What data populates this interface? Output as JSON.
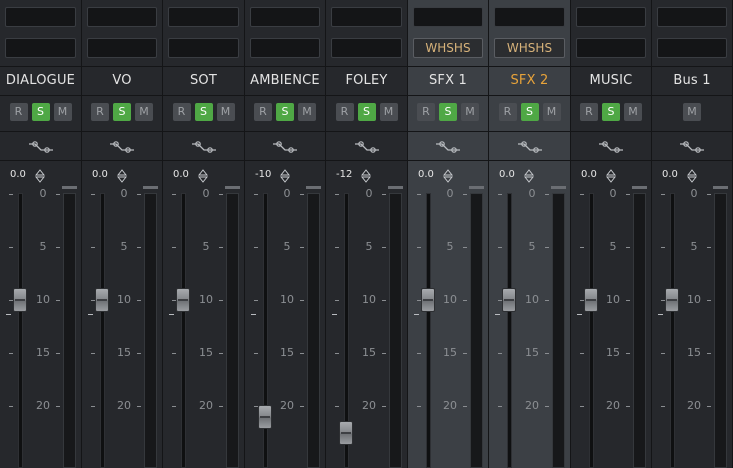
{
  "channels": [
    {
      "name": "DIALOGUE",
      "insert": "",
      "accent": false,
      "selected": false,
      "buttons": [
        "R",
        "S",
        "M"
      ],
      "gain": "0.0",
      "fader_db": 10
    },
    {
      "name": "VO",
      "insert": "",
      "accent": false,
      "selected": false,
      "buttons": [
        "R",
        "S",
        "M"
      ],
      "gain": "0.0",
      "fader_db": 10
    },
    {
      "name": "SOT",
      "insert": "",
      "accent": false,
      "selected": false,
      "buttons": [
        "R",
        "S",
        "M"
      ],
      "gain": "0.0",
      "fader_db": 10
    },
    {
      "name": "AMBIENCE",
      "insert": "",
      "accent": false,
      "selected": false,
      "buttons": [
        "R",
        "S",
        "M"
      ],
      "gain": "-10",
      "fader_db": 21
    },
    {
      "name": "FOLEY",
      "insert": "",
      "accent": false,
      "selected": false,
      "buttons": [
        "R",
        "S",
        "M"
      ],
      "gain": "-12",
      "fader_db": 22.5
    },
    {
      "name": "SFX 1",
      "insert": "WHSHS",
      "accent": false,
      "selected": true,
      "buttons": [
        "R",
        "S",
        "M"
      ],
      "gain": "0.0",
      "fader_db": 10
    },
    {
      "name": "SFX 2",
      "insert": "WHSHS",
      "accent": true,
      "selected": true,
      "buttons": [
        "R",
        "S",
        "M"
      ],
      "gain": "0.0",
      "fader_db": 10
    },
    {
      "name": "MUSIC",
      "insert": "",
      "accent": false,
      "selected": false,
      "buttons": [
        "R",
        "S",
        "M"
      ],
      "gain": "0.0",
      "fader_db": 10
    },
    {
      "name": "Bus 1",
      "insert": "",
      "accent": false,
      "selected": false,
      "buttons": [
        "M"
      ],
      "gain": "0.0",
      "fader_db": 10
    }
  ],
  "scale_labels": [
    "0",
    "5",
    "10",
    "15",
    "20"
  ],
  "colors": {
    "solo_active": "#4fa845",
    "accent_name": "#e8a33a",
    "insert_label": "#d7b27a"
  },
  "icons": {
    "automation": "automation-curve-icon",
    "gain_spinner": "up-down-spinner-icon"
  }
}
